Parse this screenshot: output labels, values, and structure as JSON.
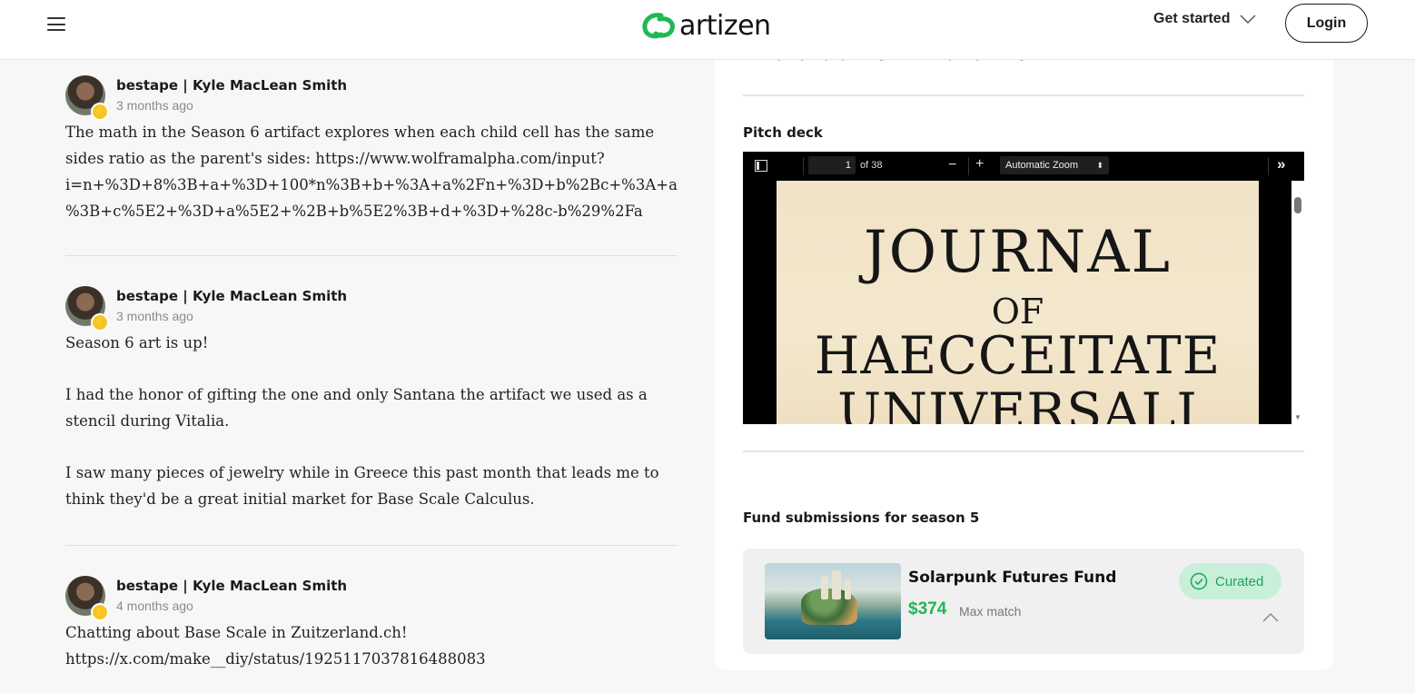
{
  "header": {
    "logo_text": "artizen",
    "get_started": "Get started",
    "login": "Login",
    "brand_color": "#1db954"
  },
  "comments": [
    {
      "author": "bestape | Kyle MacLean Smith",
      "time": "3 months ago",
      "paragraphs": [
        "The math in the Season 6 artifact explores when each child cell has the same sides ratio as the parent's sides: https://www.wolframalpha.com/input?i=n+%3D+8%3B+a+%3D+100*n%3B+b+%3A+a%2Fn+%3D+b%2Bc+%3A+a%3B+c%5E2+%3D+a%5E2+%2B+b%5E2%3B+d+%3D+%28c-b%29%2Fa"
      ]
    },
    {
      "author": "bestape | Kyle MacLean Smith",
      "time": "3 months ago",
      "paragraphs": [
        "Season 6 art is up!",
        "I had the honor of gifting the one and only Santana the artifact we used as a stencil during Vitalia.",
        "I saw many pieces of jewelry while in Greece this past month that leads me to think they'd be a great initial market for Base Scale Calculus."
      ]
    },
    {
      "author": "bestape | Kyle MacLean Smith",
      "time": "4 months ago",
      "paragraphs": [
        "Chatting about Base Scale in Zuitzerland.ch! https://x.com/make__diy/status/1925117037816488083"
      ]
    }
  ],
  "panel": {
    "clipped_text": "other people (especially architects) surpass my abilities.",
    "pitch_deck_label": "Pitch deck",
    "pdf": {
      "page_number": "1",
      "page_count": "of 38",
      "zoom": "Automatic Zoom",
      "title_lines": [
        "JOURNAL",
        "OF",
        "HAECCEITATE",
        "UNIVERSALI"
      ]
    },
    "fund_label": "Fund submissions for season 5",
    "fund": {
      "name": "Solarpunk Futures Fund",
      "amount": "$374",
      "match_label": "Max match",
      "status": "Curated"
    }
  }
}
